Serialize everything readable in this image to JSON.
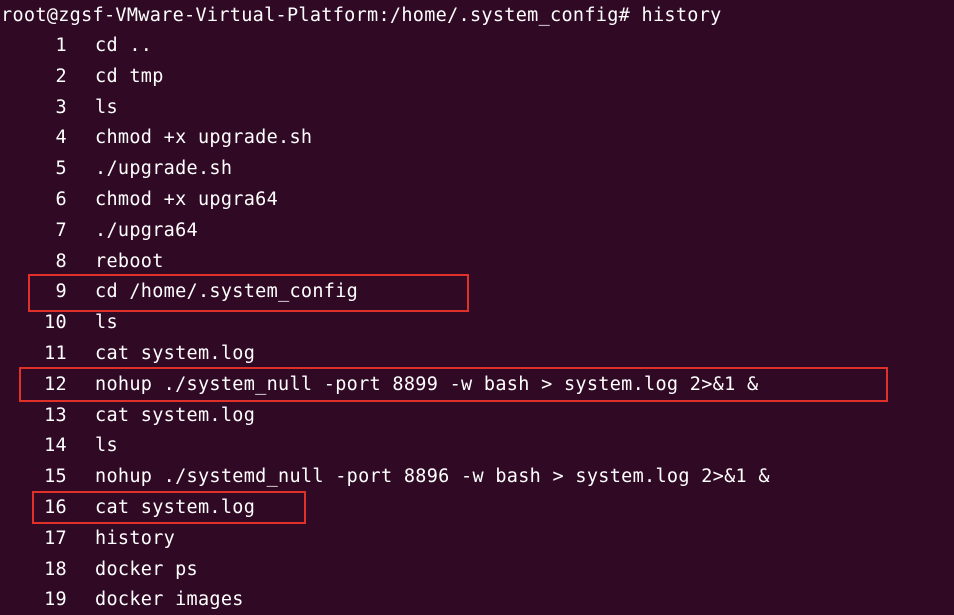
{
  "terminal": {
    "prompt": "root@zgsf-VMware-Virtual-Platform:/home/.system_config# history",
    "entries": [
      {
        "num": "1",
        "cmd": "cd .."
      },
      {
        "num": "2",
        "cmd": "cd tmp"
      },
      {
        "num": "3",
        "cmd": "ls"
      },
      {
        "num": "4",
        "cmd": "chmod +x upgrade.sh"
      },
      {
        "num": "5",
        "cmd": "./upgrade.sh"
      },
      {
        "num": "6",
        "cmd": "chmod +x upgra64"
      },
      {
        "num": "7",
        "cmd": "./upgra64"
      },
      {
        "num": "8",
        "cmd": "reboot"
      },
      {
        "num": "9",
        "cmd": "cd /home/.system_config"
      },
      {
        "num": "10",
        "cmd": "ls"
      },
      {
        "num": "11",
        "cmd": "cat system.log"
      },
      {
        "num": "12",
        "cmd": "nohup ./system_null -port 8899 -w bash > system.log 2>&1 &"
      },
      {
        "num": "13",
        "cmd": "cat system.log"
      },
      {
        "num": "14",
        "cmd": "ls"
      },
      {
        "num": "15",
        "cmd": "nohup ./systemd_null -port 8896 -w bash > system.log 2>&1 &"
      },
      {
        "num": "16",
        "cmd": "cat system.log"
      },
      {
        "num": "17",
        "cmd": "history"
      },
      {
        "num": "18",
        "cmd": "docker ps"
      },
      {
        "num": "19",
        "cmd": "docker images"
      }
    ]
  },
  "colors": {
    "background": "#300a24",
    "text": "#ffffff",
    "highlight": "#e0302a"
  }
}
